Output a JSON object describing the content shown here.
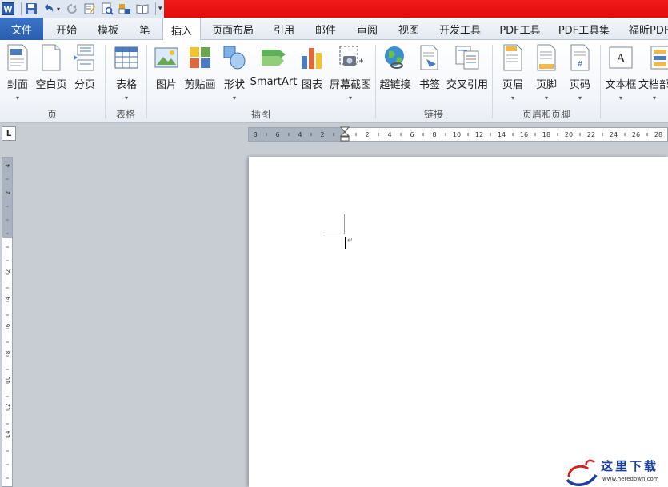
{
  "quick_access": {
    "icons": [
      "word-logo-icon",
      "save-icon",
      "undo-icon",
      "undo-dropdown-icon",
      "redo-icon",
      "edit-icon",
      "print-preview-icon",
      "layout-icon",
      "reading-icon",
      "customize-dropdown-icon"
    ]
  },
  "tabs": [
    "文件",
    "开始",
    "模板",
    "笔",
    "插入",
    "页面布局",
    "引用",
    "邮件",
    "审阅",
    "视图",
    "开发工具",
    "PDF工具",
    "PDF工具集",
    "福昕PDF"
  ],
  "active_tab": "插入",
  "ribbon": {
    "buttons": {
      "cover": "封面",
      "blank_page": "空白页",
      "page_break": "分页",
      "table": "表格",
      "picture": "图片",
      "clipart": "剪贴画",
      "shapes": "形状",
      "smartart": "SmartArt",
      "chart": "图表",
      "screenshot": "屏幕截图",
      "hyperlink": "超链接",
      "bookmark": "书签",
      "cross_reference": "交叉引用",
      "header": "页眉",
      "footer": "页脚",
      "page_number": "页码",
      "textbox": "文本框",
      "quick_parts": "文档部"
    },
    "groups": {
      "pages": "页",
      "tables": "表格",
      "illustrations": "插图",
      "links": "链接",
      "header_footer": "页眉和页脚"
    },
    "dropdown_arrow": "▾"
  },
  "ruler": {
    "horizontal_ticks": [
      "8",
      "6",
      "4",
      "2",
      "2",
      "4",
      "6",
      "8",
      "10",
      "12",
      "14",
      "16",
      "18",
      "20",
      "22",
      "24",
      "26",
      "28"
    ],
    "vertical_ticks": [
      "4",
      "2",
      "2",
      "4",
      "6",
      "8",
      "10",
      "12",
      "14"
    ],
    "tab_selector": "L"
  },
  "document": {
    "paragraph_mark": "↵"
  },
  "watermark": {
    "title": "这里下载",
    "url": "www.heredown.com"
  },
  "colors": {
    "file_tab": "#2a5db0",
    "title_red": "#e40a0a",
    "ribbon_bg": "#f3f6fa"
  }
}
